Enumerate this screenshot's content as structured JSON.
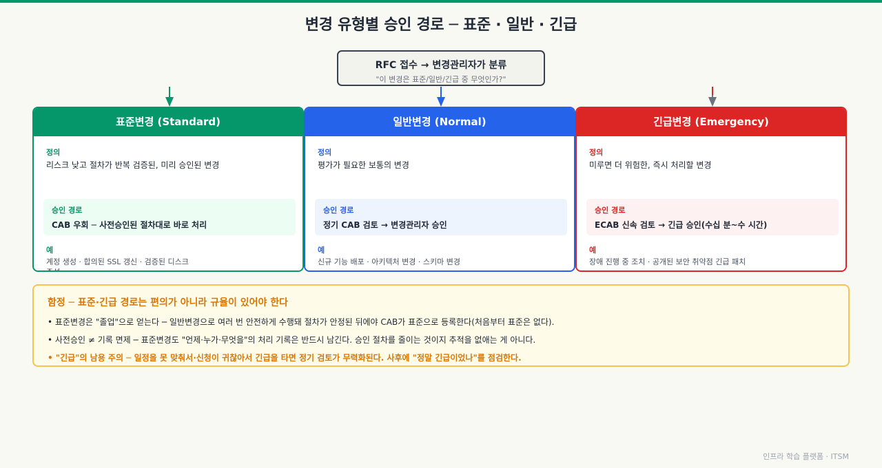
{
  "title": "변경 유형별 승인 경로 ─ 표준 · 일반 · 긴급",
  "rfc": {
    "title": "RFC 접수 → 변경관리자가 분류",
    "subtitle": "\"이 변경은 표준/일반/긴급 중 무엇인가?\""
  },
  "colors": {
    "standard": "#059669",
    "normal": "#2563eb",
    "emergency": "#dc2626",
    "pitfall": "#d97706"
  },
  "cards": [
    {
      "header": "표준변경 (Standard)",
      "definition_label": "정의",
      "definition": "리스크 낮고 절차가 반복 검증된, 미리 승인된 변경",
      "path_label": "승인 경로",
      "path": "CAB 우회 ─ 사전승인된 절차대로 바로 처리",
      "example_label": "예",
      "examples": "계정 생성 · 합의된 SSL 갱신 · 검증된 디스크 증설"
    },
    {
      "header": "일반변경 (Normal)",
      "definition_label": "정의",
      "definition": "평가가 필요한 보통의 변경",
      "path_label": "승인 경로",
      "path": "정기 CAB 검토 → 변경관리자 승인",
      "example_label": "예",
      "examples": "신규 기능 배포 · 아키텍처 변경 · 스키마 변경"
    },
    {
      "header": "긴급변경 (Emergency)",
      "definition_label": "정의",
      "definition": "미루면 더 위험한, 즉시 처리할 변경",
      "path_label": "승인 경로",
      "path": "ECAB 신속 검토 → 긴급 승인(수십 분~수 시간)",
      "example_label": "예",
      "examples": "장애 진행 중 조치 · 공개된 보안 취약점 긴급 패치"
    }
  ],
  "pitfall": {
    "title": "함정 ─ 표준·긴급 경로는 편의가 아니라 규율이 있어야 한다",
    "bullets": [
      "• 표준변경은 \"졸업\"으로 얻는다 ─ 일반변경으로 여러 번 안전하게 수행돼 절차가 안정된 뒤에야 CAB가 표준으로 등록한다(처음부터 표준은 없다).",
      "• 사전승인 ≠ 기록 면제 ─ 표준변경도 \"언제·누가·무엇을\"의 처리 기록은 반드시 남긴다. 승인 절차를 줄이는 것이지 추적을 없애는 게 아니다.",
      "• \"긴급\"의 남용 주의 ─ 일정을 못 맞춰서·신청이 귀찮아서 긴급을 타면 정기 검토가 무력화된다. 사후에 \"정말 긴급이었나\"를 점검한다."
    ]
  },
  "footer": "인프라 학습 플랫폼 · ITSM"
}
